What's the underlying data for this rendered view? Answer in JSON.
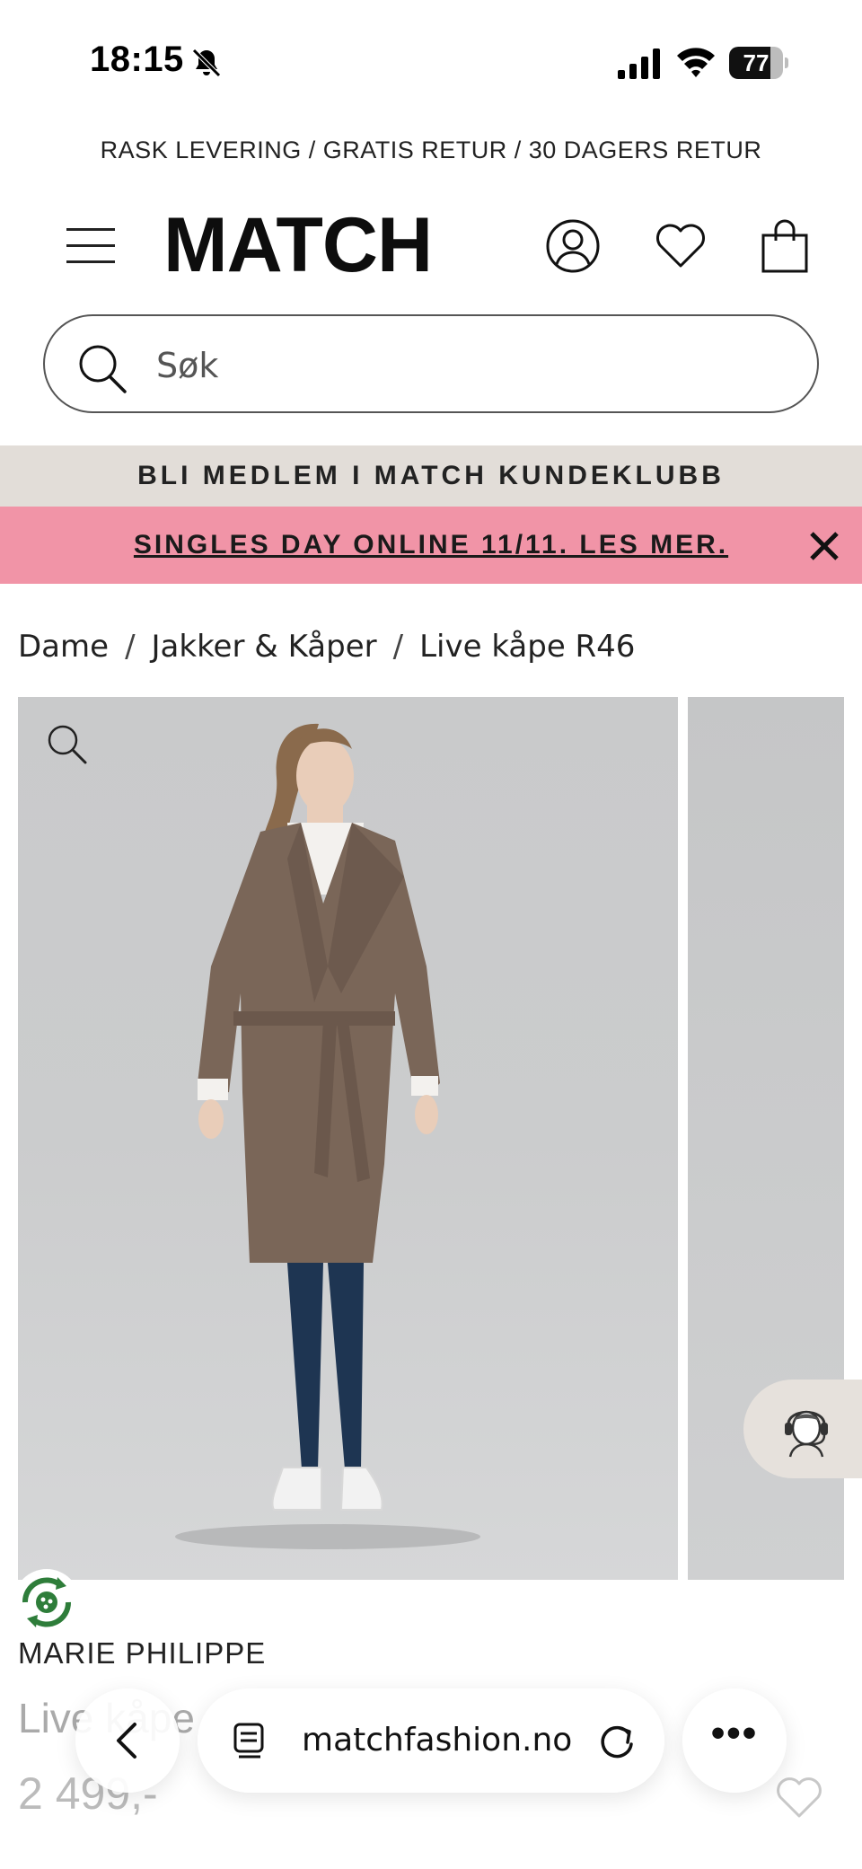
{
  "status_bar": {
    "time": "18:15",
    "battery_level": "77",
    "battery_fraction": 0.77,
    "icons": [
      "bell-off-icon",
      "signal-icon",
      "wifi-icon",
      "battery-icon"
    ]
  },
  "promo_top": "RASK LEVERING / GRATIS RETUR / 30 DAGERS RETUR",
  "header": {
    "logo": "MATCH",
    "icons": [
      "menu-icon",
      "account-icon",
      "heart-icon",
      "bag-icon"
    ]
  },
  "search": {
    "placeholder": "Søk"
  },
  "banners": {
    "club": "BLI MEDLEM I MATCH KUNDEKLUBB",
    "singles": "SINGLES DAY ONLINE 11/11. LES MER."
  },
  "breadcrumb": {
    "items": [
      "Dame",
      "Jakker & Kåper",
      "Live kåpe R46"
    ],
    "separator": "/"
  },
  "product": {
    "brand": "MARIE PHILIPPE",
    "name": "Live kåpe",
    "price": "2 499,-",
    "coat_color": "#7a6658",
    "jeans_color": "#1e3552"
  },
  "browser": {
    "url": "matchfashion.no",
    "more": "•••"
  },
  "colors": {
    "club_banner_bg": "#e2ddd8",
    "singles_banner_bg": "#f194a7",
    "chat_bg": "#e6e1dc",
    "eco_green": "#2e7d3a"
  }
}
